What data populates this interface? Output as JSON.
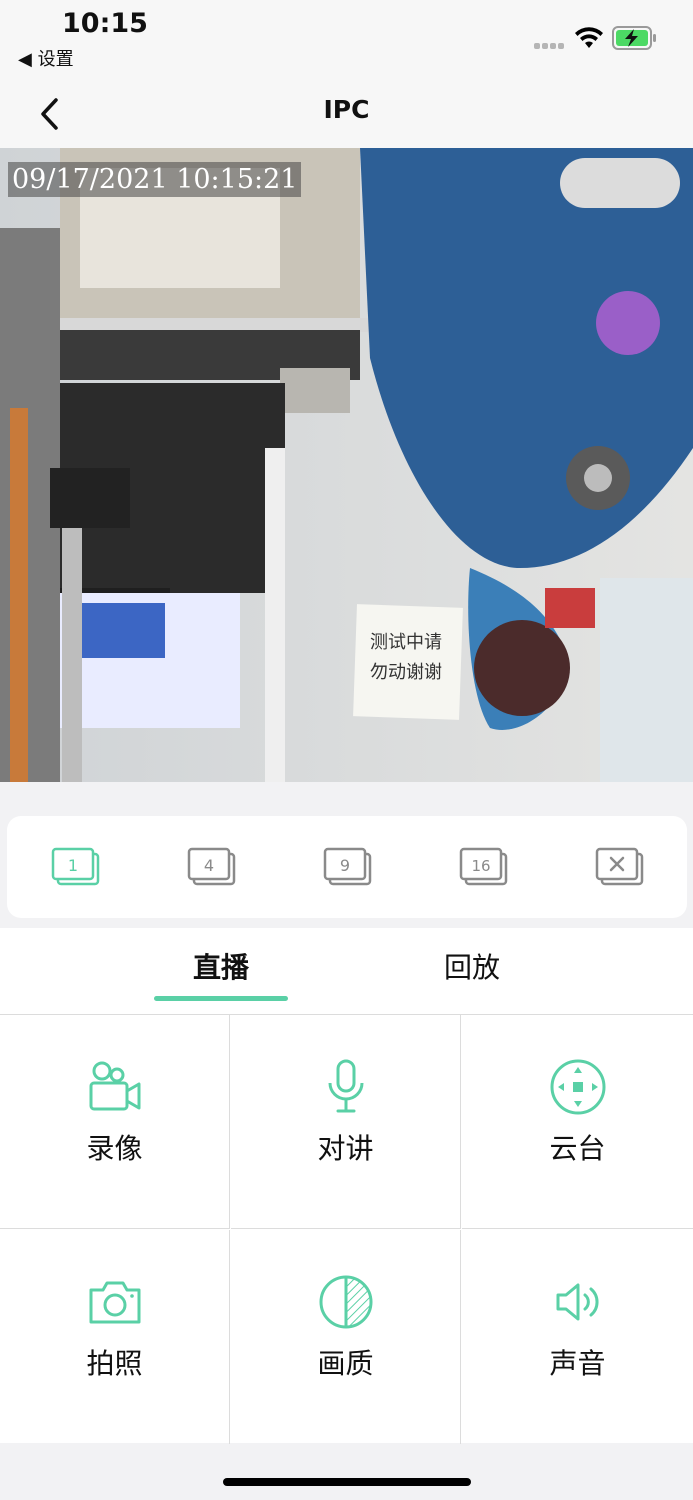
{
  "status": {
    "time": "10:15",
    "back_app": "◀ 设置"
  },
  "nav": {
    "title": "IPC"
  },
  "video": {
    "timestamp": "09/17/2021 10:15:21"
  },
  "layout_options": [
    "1",
    "4",
    "9",
    "16"
  ],
  "tabs": [
    {
      "label": "直播",
      "active": true
    },
    {
      "label": "回放",
      "active": false
    }
  ],
  "functions": [
    {
      "label": "录像",
      "icon": "video-camera-icon"
    },
    {
      "label": "对讲",
      "icon": "microphone-icon"
    },
    {
      "label": "云台",
      "icon": "ptz-icon"
    },
    {
      "label": "拍照",
      "icon": "camera-icon"
    },
    {
      "label": "画质",
      "icon": "quality-icon"
    },
    {
      "label": "声音",
      "icon": "speaker-icon"
    }
  ],
  "colors": {
    "accent": "#5ad0a6",
    "inactive_icon": "#8a8a8a"
  }
}
